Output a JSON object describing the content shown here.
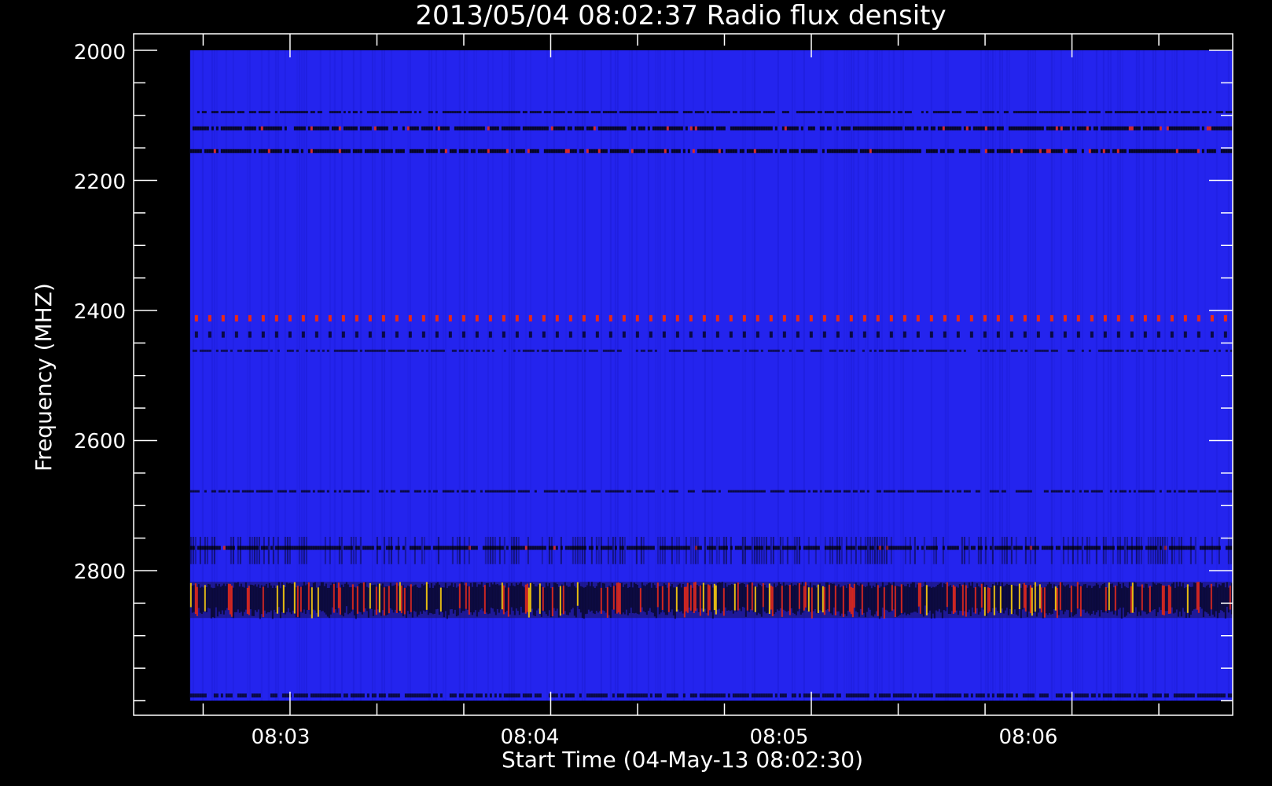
{
  "chart_data": {
    "type": "heatmap",
    "title": "2013/05/04 08:02:37 Radio flux density",
    "xlabel": "Start Time (04-May-13 08:02:30)",
    "ylabel": "Frequency (MHZ)",
    "x_start": "08:02:30",
    "xlim": [
      "08:02:24",
      "08:06:37"
    ],
    "ylim": [
      2000,
      3020
    ],
    "data_x_range": [
      "08:02:37",
      "08:06:37"
    ],
    "data_y_range": [
      2000,
      3000
    ],
    "y_reversed": true,
    "x_ticks_major": [
      "08:03",
      "08:04",
      "08:05",
      "08:06"
    ],
    "y_ticks_major": [
      2000,
      2200,
      2400,
      2600,
      2800
    ],
    "y_tick_labels": [
      "2000",
      "2200",
      "2400",
      "2600",
      "2800"
    ],
    "colormap": {
      "background": "#2424ee",
      "low": "#000000",
      "mid": "#ff2a00",
      "high": "#ffd000"
    },
    "features": [
      {
        "freq": 2095,
        "kind": "dark",
        "strength": 0.6
      },
      {
        "freq": 2120,
        "kind": "mixed",
        "strength": 0.8
      },
      {
        "freq": 2155,
        "kind": "mixed",
        "strength": 0.85
      },
      {
        "freq": 2412,
        "kind": "dotted-bright",
        "strength": 0.9
      },
      {
        "freq": 2437,
        "kind": "dotted-dark",
        "strength": 0.7
      },
      {
        "freq": 2462,
        "kind": "dark",
        "strength": 0.3
      },
      {
        "freq": 2678,
        "kind": "dark",
        "strength": 0.5
      },
      {
        "freq": 2765,
        "kind": "mixed",
        "strength": 0.7
      },
      {
        "freq": 2845,
        "kind": "burst",
        "strength": 1.0
      },
      {
        "freq": 2992,
        "kind": "mixed",
        "strength": 0.5
      }
    ]
  }
}
